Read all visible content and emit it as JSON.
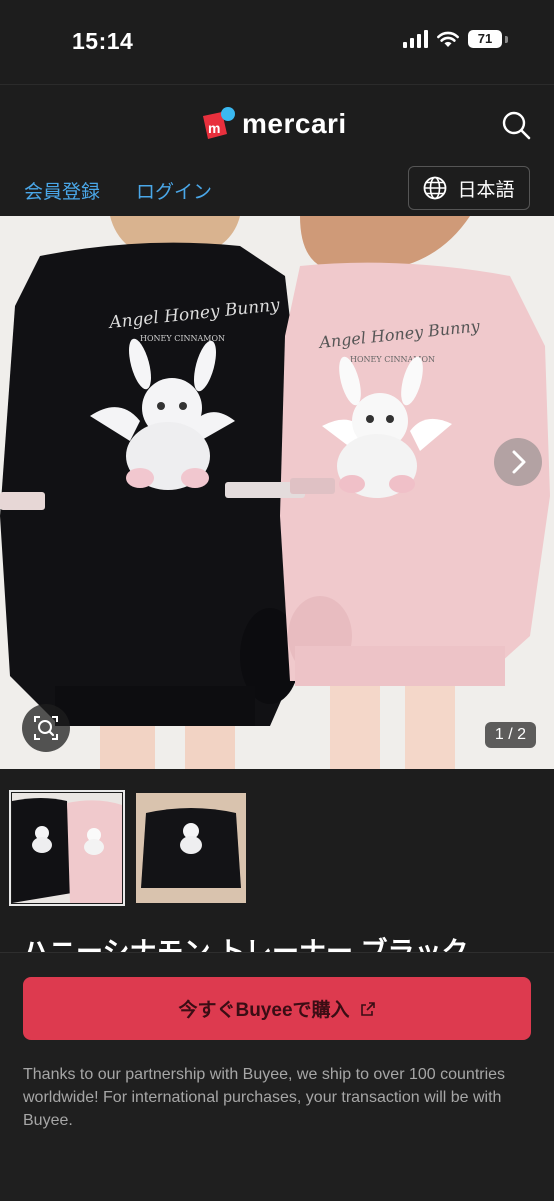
{
  "status_bar": {
    "time": "15:14",
    "battery": "71"
  },
  "header": {
    "logo_text": "mercari",
    "logo_mark": "m"
  },
  "auth_links": {
    "register": "会員登録",
    "login": "ログイン"
  },
  "language": {
    "label": "日本語"
  },
  "gallery": {
    "counter": "1 / 2",
    "print_text": "Angel Honey Bunny",
    "print_subtext": "HONEY CINNAMON",
    "colors": {
      "black_item": "#111114",
      "pink_item": "#f0c9cc",
      "background": "#ece9e6"
    }
  },
  "product": {
    "title": "ハニーシナモン トレーナー ブラック"
  },
  "purchase": {
    "button_label": "今すぐBuyeeで購入",
    "note": "Thanks to our partnership with Buyee, we ship to over 100 countries worldwide! For international purchases, your transaction will be with Buyee."
  },
  "theme": {
    "accent": "#dd3a4f",
    "link": "#4aa7e8",
    "background": "#1d1d1d"
  }
}
